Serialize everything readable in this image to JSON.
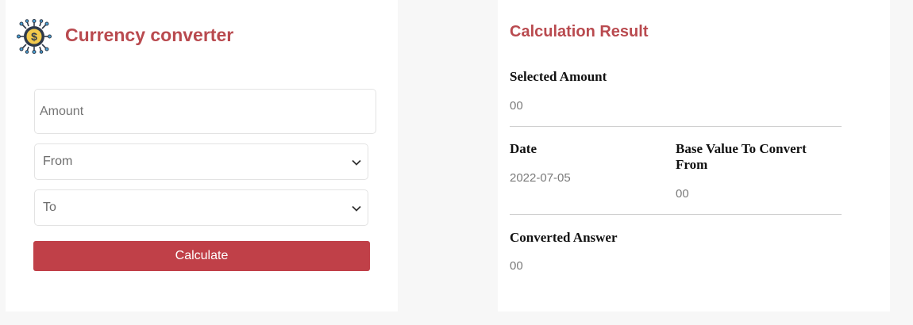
{
  "converter": {
    "title": "Currency converter",
    "logo_icon": "currency-circuit-icon",
    "amount": {
      "value": "",
      "placeholder": "Amount"
    },
    "from_select": {
      "selected": "From"
    },
    "to_select": {
      "selected": "To"
    },
    "calculate_label": "Calculate",
    "colors": {
      "accent": "#b94a4f",
      "button": "#c04048"
    }
  },
  "result": {
    "title": "Calculation Result",
    "selected_amount": {
      "label": "Selected Amount",
      "value": "00"
    },
    "date": {
      "label": "Date",
      "value": "2022-07-05"
    },
    "base_value": {
      "label": "Base Value To Convert From",
      "value": "00"
    },
    "converted_answer": {
      "label": "Converted Answer",
      "value": "00"
    }
  }
}
